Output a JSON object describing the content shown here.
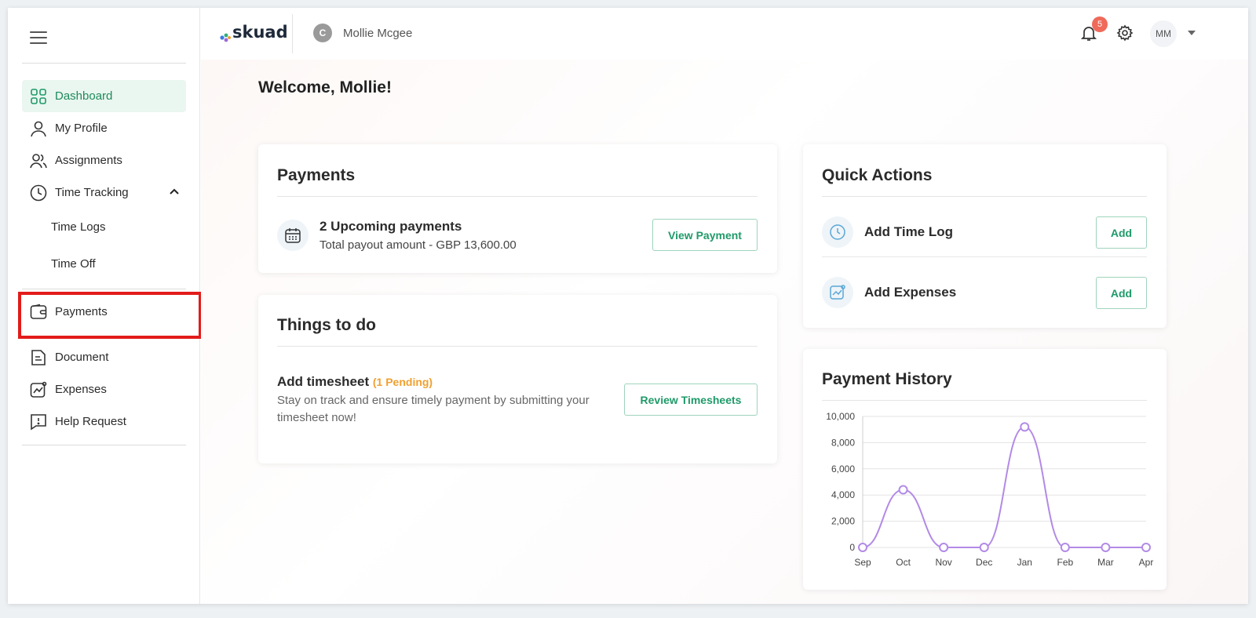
{
  "app": {
    "logo_text": "skuad",
    "company_initial": "C",
    "company_name": "Mollie Mcgee",
    "notification_count": "5",
    "user_initials": "MM"
  },
  "sidebar": {
    "items": [
      {
        "label": "Dashboard",
        "icon": "grid-icon",
        "active": true
      },
      {
        "label": "My Profile",
        "icon": "user-icon"
      },
      {
        "label": "Assignments",
        "icon": "users-icon"
      },
      {
        "label": "Time Tracking",
        "icon": "clock-icon",
        "expanded": true
      },
      {
        "label": "Payments",
        "icon": "wallet-icon"
      },
      {
        "label": "Document",
        "icon": "document-icon"
      },
      {
        "label": "Expenses",
        "icon": "expenses-chart-icon"
      },
      {
        "label": "Help Request",
        "icon": "chat-alert-icon"
      }
    ],
    "time_tracking_children": [
      "Time Logs",
      "Time Off"
    ]
  },
  "main": {
    "welcome": "Welcome, Mollie!",
    "payments_card": {
      "title": "Payments",
      "heading": "2 Upcoming payments",
      "subtext": "Total payout amount - GBP 13,600.00",
      "button": "View Payment"
    },
    "todo_card": {
      "title": "Things to do",
      "heading": "Add timesheet",
      "pending": "(1 Pending)",
      "desc_line1": "Stay on track and ensure timely payment by submitting your",
      "desc_line2": "timesheet now!",
      "button": "Review Timesheets"
    },
    "quick_actions": {
      "title": "Quick Actions",
      "items": [
        {
          "label": "Add Time Log",
          "button": "Add",
          "icon": "clock-icon"
        },
        {
          "label": "Add Expenses",
          "button": "Add",
          "icon": "expenses-chart-icon"
        }
      ]
    },
    "payment_history": {
      "title": "Payment History"
    }
  },
  "colors": {
    "accent": "#1f9a6a",
    "line": "#b28ae6",
    "highlight_red": "#e31b1b",
    "pending": "#f0a030"
  },
  "chart_data": {
    "type": "line",
    "title": "Payment History",
    "categories": [
      "Sep",
      "Oct",
      "Nov",
      "Dec",
      "Jan",
      "Feb",
      "Mar",
      "Apr"
    ],
    "values": [
      0,
      4400,
      0,
      0,
      9200,
      0,
      0,
      0
    ],
    "ylim": [
      0,
      10000
    ],
    "yticks": [
      "0",
      "2,000",
      "4,000",
      "6,000",
      "8,000",
      "10,000"
    ],
    "grid": true
  }
}
